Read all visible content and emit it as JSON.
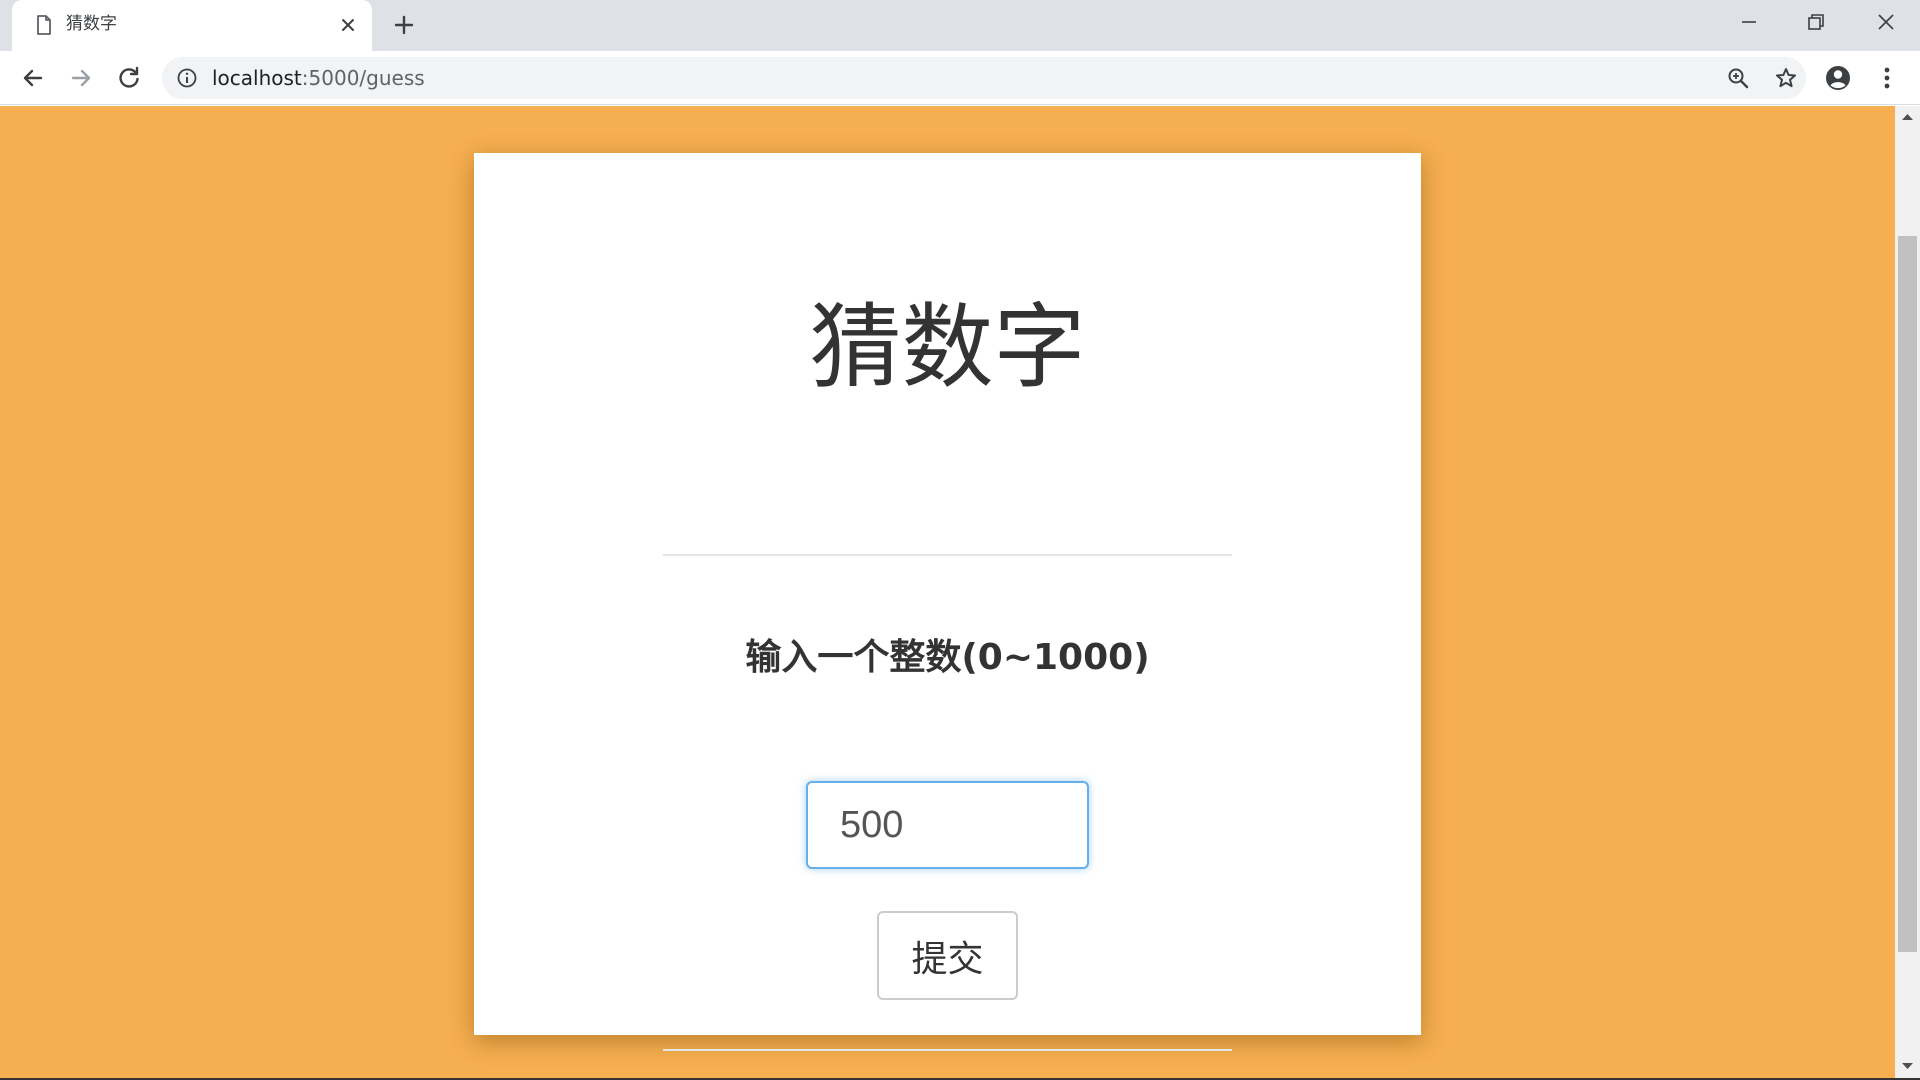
{
  "browser": {
    "tab": {
      "title": "猜数字"
    },
    "address_bar": {
      "host": "localhost",
      "path": ":5000/guess"
    }
  },
  "page": {
    "title": "猜数字",
    "prompt": "输入一个整数(0~1000)",
    "input_value": "500",
    "submit_label": "提交"
  },
  "colors": {
    "page_background": "#f5ae50",
    "card_background": "#ffffff",
    "input_focus_border": "#66afe9"
  },
  "icons": {
    "tab": "page-icon",
    "tab_close": "close-icon",
    "new_tab": "plus-icon",
    "minimize": "minimize-icon",
    "restore": "restore-icon",
    "close_window": "close-icon",
    "back": "back-arrow-icon",
    "forward": "forward-arrow-icon",
    "reload": "reload-icon",
    "site_info": "info-icon",
    "zoom": "zoom-in-icon",
    "bookmark": "star-icon",
    "profile": "account-icon",
    "menu": "vertical-dots-icon"
  }
}
